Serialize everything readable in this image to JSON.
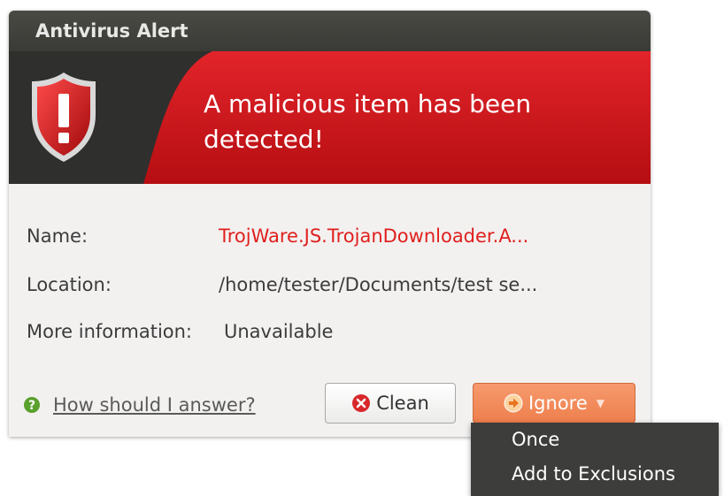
{
  "window": {
    "title": "Antivirus Alert"
  },
  "banner": {
    "headline": "A malicious item has been detected!"
  },
  "details": {
    "name_label": "Name:",
    "name_value": "TrojWare.JS.TrojanDownloader.A...",
    "location_label": "Location:",
    "location_value": "/home/tester/Documents/test  se...",
    "more_info_label": "More information:",
    "more_info_value": "Unavailable"
  },
  "footer": {
    "help_link": "How should I answer?",
    "clean_label": "Clean",
    "ignore_label": "Ignore"
  },
  "ignore_menu": {
    "items": [
      "Once",
      "Add to Exclusions"
    ]
  },
  "colors": {
    "banner_red": "#d2141c",
    "threat_text": "#e0201e",
    "ignore_button": "#f08454",
    "menu_bg": "#3d3d3b"
  },
  "icons": {
    "banner": "shield-exclamation-icon",
    "help": "help-question-icon",
    "clean": "red-x-icon",
    "ignore": "orange-arrow-icon"
  }
}
